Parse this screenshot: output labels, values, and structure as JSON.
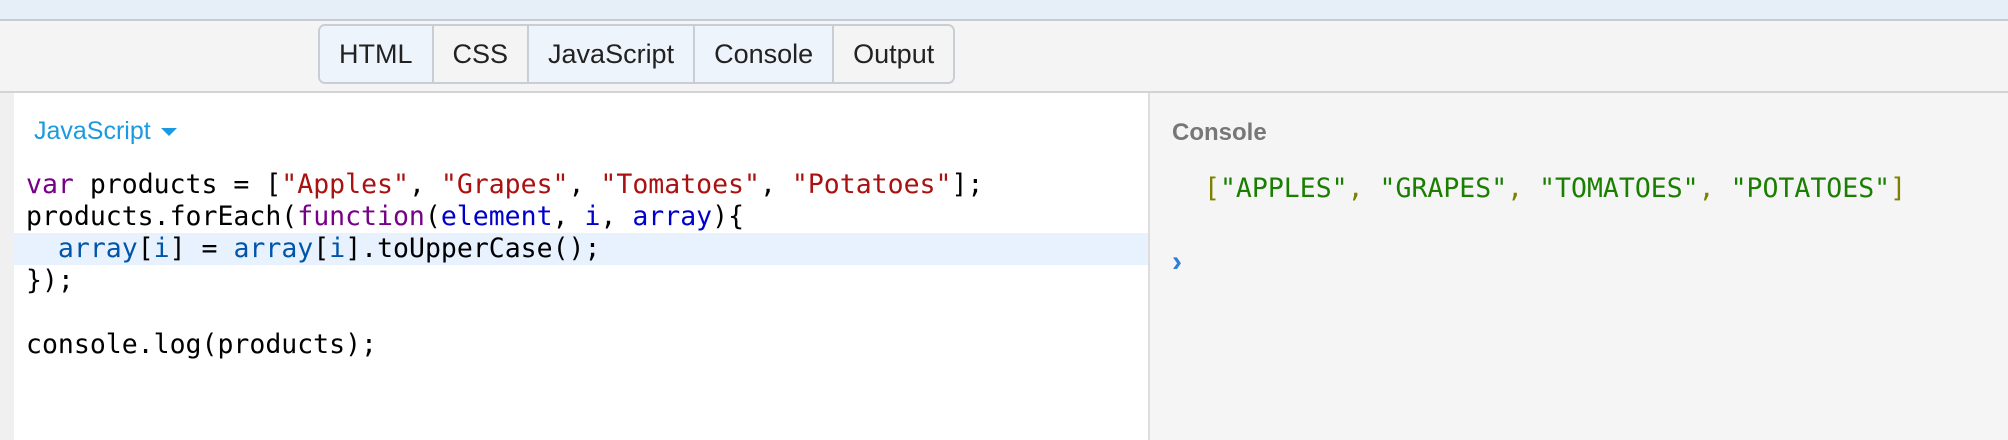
{
  "tabs": [
    {
      "label": "HTML",
      "active": true
    },
    {
      "label": "CSS",
      "active": false
    },
    {
      "label": "JavaScript",
      "active": true
    },
    {
      "label": "Console",
      "active": true
    },
    {
      "label": "Output",
      "active": false
    }
  ],
  "editor": {
    "language_label": "JavaScript",
    "code": {
      "l1_kw": "var",
      "l1_a": " products = [",
      "l1_s1": "\"Apples\"",
      "l1_c1": ", ",
      "l1_s2": "\"Grapes\"",
      "l1_c2": ", ",
      "l1_s3": "\"Tomatoes\"",
      "l1_c3": ", ",
      "l1_s4": "\"Potatoes\"",
      "l1_end": "];",
      "l2_a": "products.forEach(",
      "l2_kw": "function",
      "l2_b": "(",
      "l2_p1": "element",
      "l2_c1": ", ",
      "l2_p2": "i",
      "l2_c2": ", ",
      "l2_p3": "array",
      "l2_end": "){",
      "l3_indent": "  ",
      "l3_v1": "array",
      "l3_b1": "[",
      "l3_v2": "i",
      "l3_b2": "] = ",
      "l3_v3": "array",
      "l3_b3": "[",
      "l3_v4": "i",
      "l3_end": "].toUpperCase();",
      "l4": "});",
      "l6": "console.log(products);"
    }
  },
  "console": {
    "title": "Console",
    "output": {
      "open": "[",
      "s1": "\"APPLES\"",
      "sep1": ", ",
      "s2": "\"GRAPES\"",
      "sep2": ", ",
      "s3": "\"TOMATOES\"",
      "sep3": ", ",
      "s4": "\"POTATOES\"",
      "close": "]"
    },
    "prompt": "›"
  },
  "colors": {
    "accent": "#1a9ae0",
    "keyword": "#770088",
    "string": "#aa1111",
    "variable": "#0000cc",
    "console_string": "#1a7f00",
    "prompt": "#2f7fd6"
  }
}
